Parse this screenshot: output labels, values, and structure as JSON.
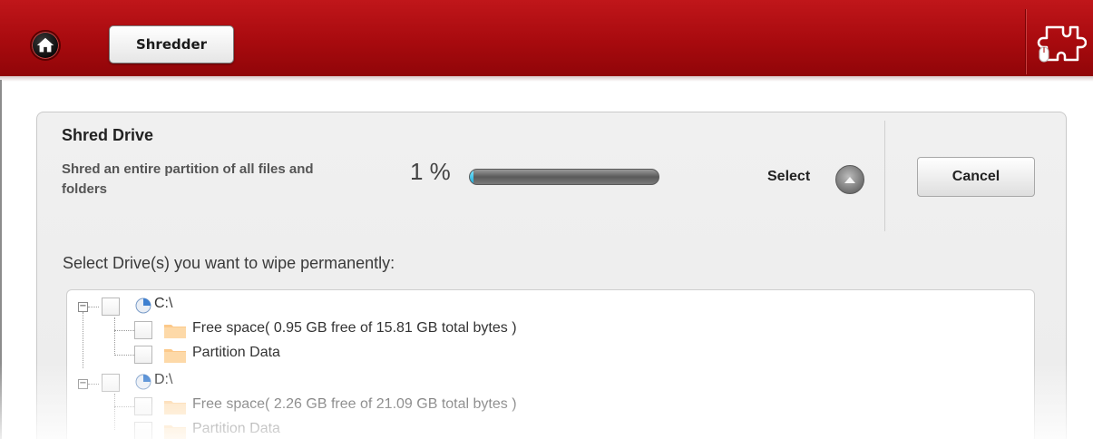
{
  "header": {
    "home_icon": "home-icon",
    "tab_label": "Shredder",
    "plugin_icon": "puzzle-mouse-icon",
    "bg_color": "#a70a0e"
  },
  "panel": {
    "title": "Shred Drive",
    "description": "Shred an entire partition of all files and folders",
    "progress_text": "1 %",
    "progress_value": 1,
    "select_label": "Select",
    "cancel_label": "Cancel",
    "prompt": "Select Drive(s) you want to wipe permanently:"
  },
  "tree": {
    "drives": [
      {
        "label": "C:\\",
        "children": [
          "Free space( 0.95 GB free of 15.81 GB total bytes )",
          "Partition Data"
        ]
      },
      {
        "label": "D:\\",
        "children": [
          "Free space( 2.26 GB free of 21.09 GB total bytes )",
          "Partition Data"
        ]
      }
    ]
  }
}
